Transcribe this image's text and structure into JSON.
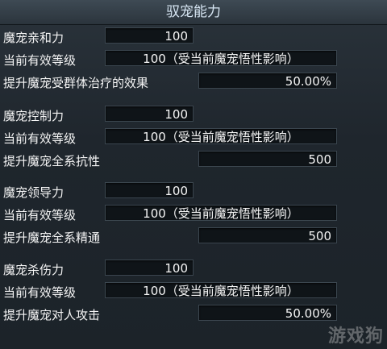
{
  "title": "驭宠能力",
  "sections": [
    {
      "name_label": "魔宠亲和力",
      "name_value": "100",
      "level_label": "当前有效等级",
      "level_value": "100（受当前魔宠悟性影响）",
      "effect_label": "提升魔宠受群体治疗的效果",
      "effect_value": "50.00%"
    },
    {
      "name_label": "魔宠控制力",
      "name_value": "100",
      "level_label": "当前有效等级",
      "level_value": "100（受当前魔宠悟性影响）",
      "effect_label": "提升魔宠全系抗性",
      "effect_value": "500"
    },
    {
      "name_label": "魔宠领导力",
      "name_value": "100",
      "level_label": "当前有效等级",
      "level_value": "100（受当前魔宠悟性影响）",
      "effect_label": "提升魔宠全系精通",
      "effect_value": "500"
    },
    {
      "name_label": "魔宠杀伤力",
      "name_value": "100",
      "level_label": "当前有效等级",
      "level_value": "100（受当前魔宠悟性影响）",
      "effect_label": "提升魔宠对人攻击",
      "effect_value": "50.00%"
    }
  ],
  "watermark": "游戏狗"
}
